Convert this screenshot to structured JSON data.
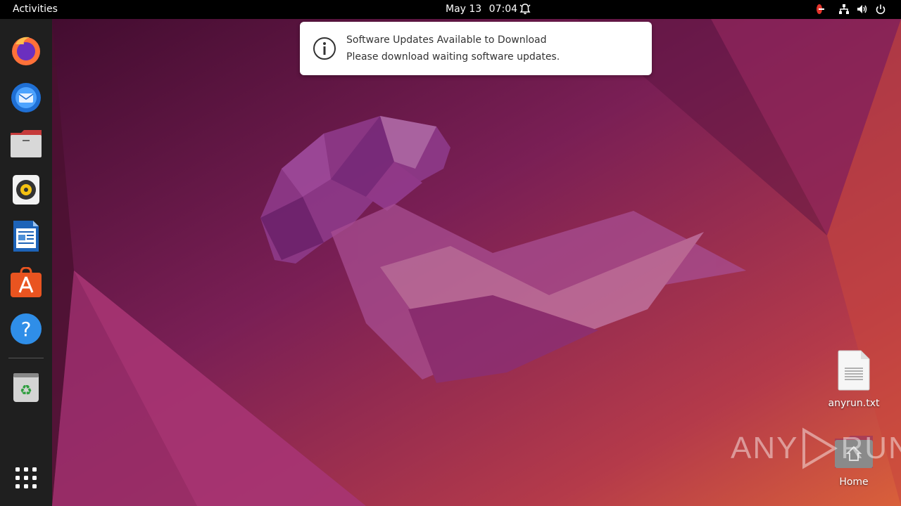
{
  "topbar": {
    "activities": "Activities",
    "date": "May 13",
    "time": "07:04"
  },
  "notification": {
    "title": "Software Updates Available to Download",
    "body": "Please download waiting software updates."
  },
  "dock": {
    "items": [
      {
        "name": "firefox",
        "icon": "firefox-icon"
      },
      {
        "name": "thunderbird",
        "icon": "thunderbird-icon"
      },
      {
        "name": "files",
        "icon": "files-icon"
      },
      {
        "name": "rhythmbox",
        "icon": "rhythmbox-icon"
      },
      {
        "name": "libreoffice-writer",
        "icon": "writer-icon"
      },
      {
        "name": "app-center",
        "icon": "app-center-icon"
      },
      {
        "name": "help",
        "icon": "help-icon"
      },
      {
        "name": "trash",
        "icon": "trash-icon"
      },
      {
        "name": "show-apps",
        "icon": "grid-icon"
      }
    ]
  },
  "desktop": {
    "file_label": "anyrun.txt",
    "home_label": "Home"
  },
  "watermark": {
    "text_left": "ANY",
    "text_right": "RUN"
  },
  "colors": {
    "topbar": "#000000",
    "dock": "#1f1f1f",
    "wallpaper_dark": "#3a0d2a",
    "wallpaper_mid": "#7c1f58",
    "wallpaper_orange": "#c24a3f"
  }
}
